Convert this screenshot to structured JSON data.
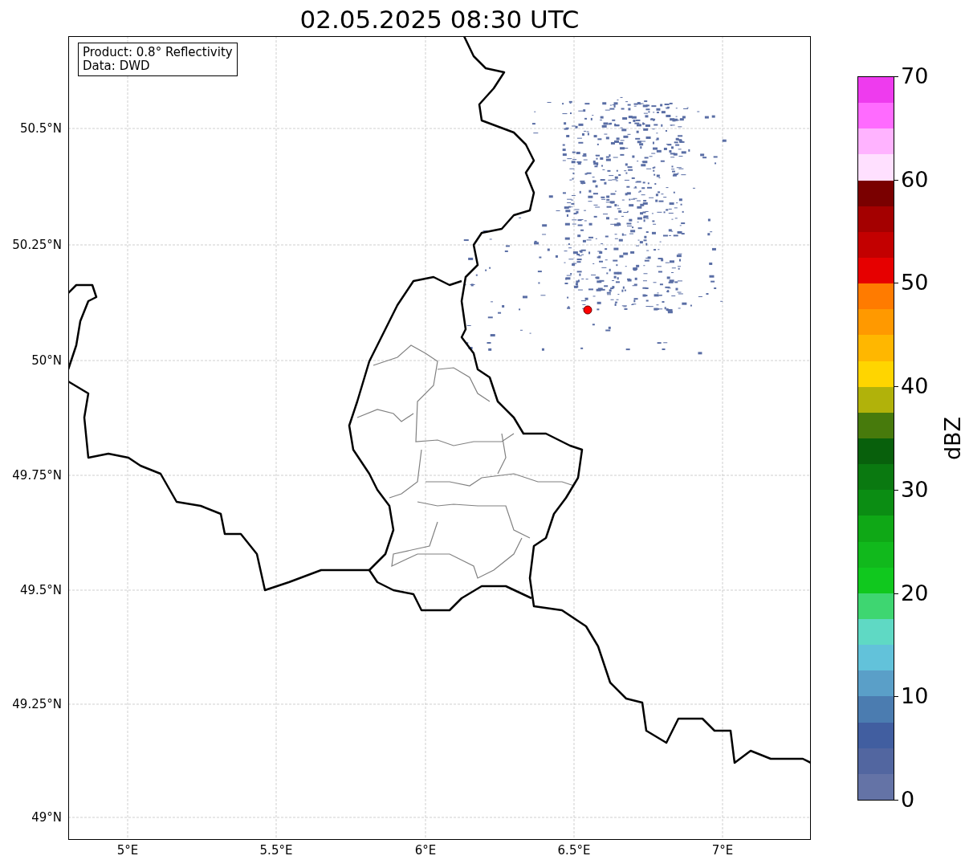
{
  "title": "02.05.2025 08:30 UTC",
  "info_box": {
    "lines": [
      "Product: 0.8° Reflectivity",
      "Data: DWD"
    ]
  },
  "map": {
    "lat_labels": [
      "50.5°N",
      "50.25°N",
      "50°N",
      "49.75°N",
      "49.5°N",
      "49.25°N",
      "49°N"
    ],
    "lon_labels": [
      "5°E",
      "5.5°E",
      "6°E",
      "6.5°E",
      "7°E"
    ]
  },
  "colorbar": {
    "label": "dBZ",
    "ticks": [
      "70",
      "60",
      "50",
      "40",
      "30",
      "20",
      "10",
      "0"
    ],
    "bins": [
      {
        "color": "#6473a6"
      },
      {
        "color": "#5266a0"
      },
      {
        "color": "#415ea0"
      },
      {
        "color": "#4b7cb0"
      },
      {
        "color": "#5a9fc8"
      },
      {
        "color": "#62c2da"
      },
      {
        "color": "#5fd9c4"
      },
      {
        "color": "#3ed671"
      },
      {
        "color": "#10c81e"
      },
      {
        "color": "#11b91c"
      },
      {
        "color": "#0fa816"
      },
      {
        "color": "#0b8d13"
      },
      {
        "color": "#0a7910"
      },
      {
        "color": "#08600c"
      },
      {
        "color": "#477a0c"
      },
      {
        "color": "#b1b20a"
      },
      {
        "color": "#ffd500"
      },
      {
        "color": "#ffb700"
      },
      {
        "color": "#ff9900"
      },
      {
        "color": "#ff7b00"
      },
      {
        "color": "#e60000"
      },
      {
        "color": "#c30000"
      },
      {
        "color": "#a40000"
      },
      {
        "color": "#7a0000"
      },
      {
        "color": "#ffe0ff"
      },
      {
        "color": "#ffb3ff"
      },
      {
        "color": "#ff6bff"
      },
      {
        "color": "#ee3bee"
      }
    ]
  }
}
